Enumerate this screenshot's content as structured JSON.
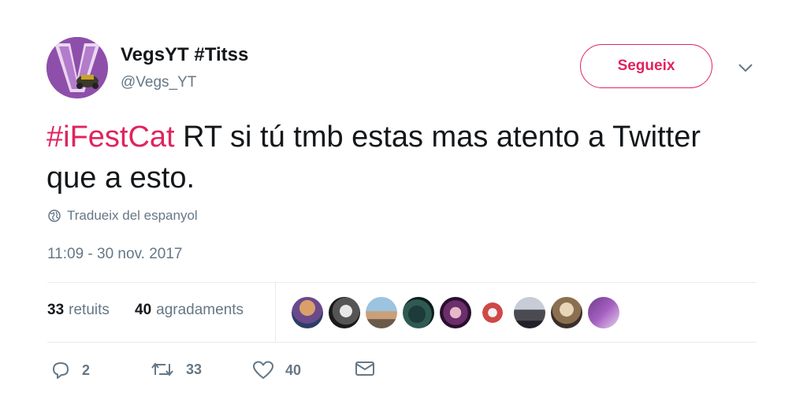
{
  "user": {
    "display_name": "VegsYT #Titss",
    "username": "@Vegs_YT",
    "avatar_icon": "profile-avatar"
  },
  "follow_button": {
    "label": "Segueix"
  },
  "menu": {
    "icon": "chevron-down-icon"
  },
  "tweet": {
    "hashtag": "#iFestCat",
    "body": " RT si tú tmb estas mas atento a Twitter que a esto."
  },
  "translate": {
    "icon": "globe-icon",
    "label": "Tradueix del espanyol"
  },
  "timestamp": "11:09 - 30 nov. 2017",
  "stats": {
    "retweets": {
      "count": "33",
      "label": "retuits"
    },
    "likes": {
      "count": "40",
      "label": "agradaments"
    }
  },
  "likers_count_shown": 9,
  "actions": {
    "reply": {
      "icon": "reply-icon",
      "count": "2"
    },
    "retweet": {
      "icon": "retweet-icon",
      "count": "33"
    },
    "like": {
      "icon": "heart-icon",
      "count": "40"
    },
    "message": {
      "icon": "envelope-icon"
    }
  },
  "colors": {
    "accent": "#e0245e",
    "secondary_text": "#657786",
    "primary_text": "#14171a",
    "divider": "#e6ecf0"
  }
}
